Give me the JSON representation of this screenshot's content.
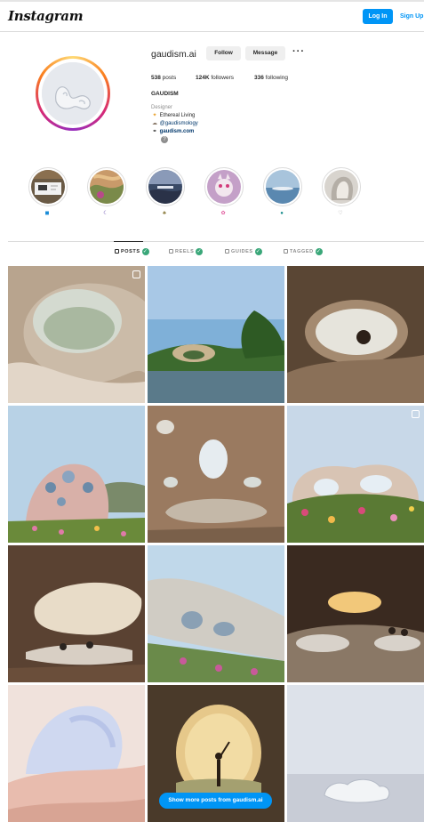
{
  "topbar": {
    "logo": "Instagram",
    "login_label": "Log In",
    "signup_label": "Sign Up"
  },
  "profile": {
    "username": "gaudism.ai",
    "follow_label": "Follow",
    "message_label": "Message",
    "more_label": "···",
    "stats": {
      "posts_count": "538",
      "posts_label": "posts",
      "followers_count": "124K",
      "followers_label": "followers",
      "following_count": "336",
      "following_label": "following"
    },
    "full_name": "GAUDISM",
    "category": "Designer",
    "bio": [
      {
        "icon": "sparkle-emoji-icon",
        "text": "Ethereal Living"
      },
      {
        "icon": "clay-emoji-icon",
        "text": "@gaudismology"
      },
      {
        "icon": "link-icon",
        "text": "gaudism.com"
      }
    ],
    "help_label": "?"
  },
  "highlights": [
    {
      "icon": "square-emoji-icon",
      "color": "#1a8cd8"
    },
    {
      "icon": "moon-emoji-icon",
      "color": "#5b3fa8"
    },
    {
      "icon": "plant-emoji-icon",
      "color": "#8a7a3a"
    },
    {
      "icon": "flower-emoji-icon",
      "color": "#e0559a"
    },
    {
      "icon": "globe-emoji-icon",
      "color": "#138a8a"
    },
    {
      "icon": "heart-emoji-icon",
      "color": "#999999"
    }
  ],
  "tabs": [
    {
      "label": "POSTS",
      "active": true
    },
    {
      "label": "REELS",
      "active": false
    },
    {
      "label": "GUIDES",
      "active": false
    },
    {
      "label": "TAGGED",
      "active": false
    }
  ],
  "grid": {
    "show_more_label": "Show more posts from gaudism.ai"
  },
  "colors": {
    "accent": "#0095f6",
    "check": "#3aa779"
  }
}
